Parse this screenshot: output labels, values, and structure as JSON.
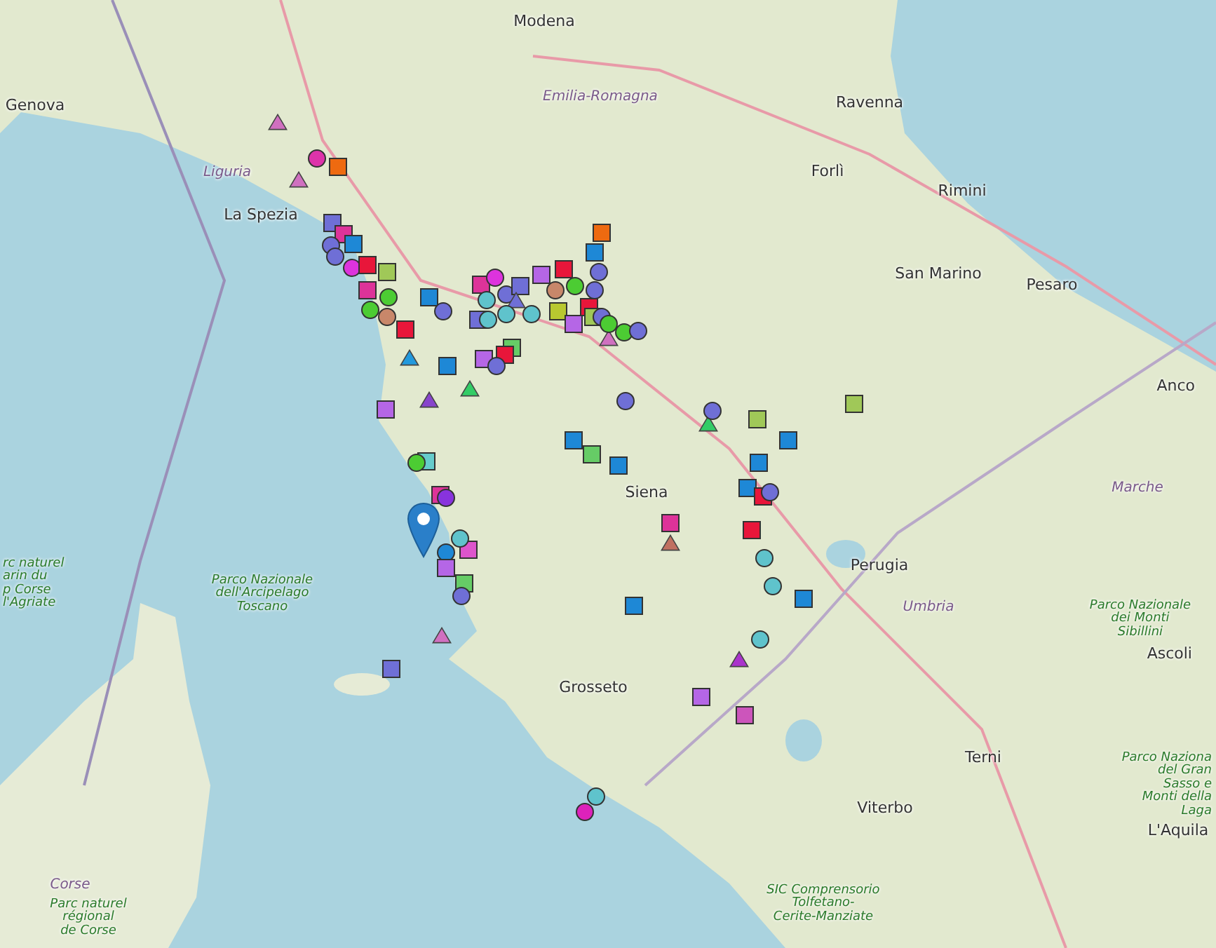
{
  "map": {
    "labels": [
      {
        "text": "Modena",
        "kind": "city"
      },
      {
        "text": "Genova",
        "kind": "city"
      },
      {
        "text": "Emilia-Romagna",
        "kind": "region"
      },
      {
        "text": "Ravenna",
        "kind": "city"
      },
      {
        "text": "Liguria",
        "kind": "region"
      },
      {
        "text": "Forlì",
        "kind": "city"
      },
      {
        "text": "Rimini",
        "kind": "city"
      },
      {
        "text": "La Spezia",
        "kind": "city"
      },
      {
        "text": "San Marino",
        "kind": "city"
      },
      {
        "text": "Pesaro",
        "kind": "city"
      },
      {
        "text": "Anco",
        "kind": "city"
      },
      {
        "text": "Siena",
        "kind": "city"
      },
      {
        "text": "Perugia",
        "kind": "city"
      },
      {
        "text": "Umbria",
        "kind": "region"
      },
      {
        "text": "Marche",
        "kind": "region"
      },
      {
        "text": "Grosseto",
        "kind": "city"
      },
      {
        "text": "Terni",
        "kind": "city"
      },
      {
        "text": "Viterbo",
        "kind": "city"
      },
      {
        "text": "Ascoli",
        "kind": "city"
      },
      {
        "text": "L'Aquila",
        "kind": "city"
      },
      {
        "text": "Parco Nazionale\ndell'Arcipelago\nToscano",
        "kind": "park"
      },
      {
        "text": "Parco Nazionale\ndei Monti\nSibillini",
        "kind": "park"
      },
      {
        "text": "rc naturel\narin du\np Corse\nl'Agriate",
        "kind": "park"
      },
      {
        "text": "Corse",
        "kind": "region"
      },
      {
        "text": "Parc naturel\nrégional\nde Corse",
        "kind": "park"
      },
      {
        "text": "Parco Naziona\ndel Gran\nSasso e\nMonti della\nLaga",
        "kind": "park"
      },
      {
        "text": "SIC Comprensorio\nTolfetano-\nCerite-Manziate",
        "kind": "park"
      }
    ],
    "markers": [
      {
        "kind": "triangle",
        "color": "#d070c0"
      },
      {
        "kind": "circle",
        "color": "#dd33aa"
      },
      {
        "kind": "square",
        "color": "#ee6a10"
      },
      {
        "kind": "triangle",
        "color": "#d070c0"
      },
      {
        "kind": "square",
        "color": "#6f6fd6"
      },
      {
        "kind": "square",
        "color": "#dd3399"
      },
      {
        "kind": "circle",
        "color": "#6f6fd6"
      },
      {
        "kind": "square",
        "color": "#1e88d6"
      },
      {
        "kind": "circle",
        "color": "#6f6fd6"
      },
      {
        "kind": "circle",
        "color": "#dd33dd"
      },
      {
        "kind": "square",
        "color": "#e8163a"
      },
      {
        "kind": "square",
        "color": "#a0c858"
      },
      {
        "kind": "square",
        "color": "#dd3399"
      },
      {
        "kind": "circle",
        "color": "#c8876a"
      },
      {
        "kind": "circle",
        "color": "#4ccc33"
      },
      {
        "kind": "circle",
        "color": "#4ccc33"
      },
      {
        "kind": "square",
        "color": "#e8163a"
      },
      {
        "kind": "square",
        "color": "#1e88d6"
      },
      {
        "kind": "circle",
        "color": "#6f6fd6"
      },
      {
        "kind": "triangle",
        "color": "#2299dd"
      },
      {
        "kind": "square",
        "color": "#1e88d6"
      },
      {
        "kind": "triangle",
        "color": "#8844cc"
      },
      {
        "kind": "triangle",
        "color": "#33cc66"
      },
      {
        "kind": "square",
        "color": "#b566e6"
      },
      {
        "kind": "square",
        "color": "#dd3399"
      },
      {
        "kind": "circle",
        "color": "#dd33dd"
      },
      {
        "kind": "circle",
        "color": "#5fc3cc"
      },
      {
        "kind": "circle",
        "color": "#6f6fd6"
      },
      {
        "kind": "square",
        "color": "#6f6fd6"
      },
      {
        "kind": "triangle",
        "color": "#6f6fd6"
      },
      {
        "kind": "square",
        "color": "#b566e6"
      },
      {
        "kind": "square",
        "color": "#e8163a"
      },
      {
        "kind": "circle",
        "color": "#c8876a"
      },
      {
        "kind": "circle",
        "color": "#4ccc33"
      },
      {
        "kind": "square",
        "color": "#e8163a"
      },
      {
        "kind": "square",
        "color": "#1e88d6"
      },
      {
        "kind": "circle",
        "color": "#6f6fd6"
      },
      {
        "kind": "circle",
        "color": "#6f6fd6"
      },
      {
        "kind": "square",
        "color": "#ee6a10"
      },
      {
        "kind": "square",
        "color": "#6f6fd6"
      },
      {
        "kind": "circle",
        "color": "#5fc3cc"
      },
      {
        "kind": "circle",
        "color": "#5fc3cc"
      },
      {
        "kind": "circle",
        "color": "#5fc3cc"
      },
      {
        "kind": "square",
        "color": "#b8c830"
      },
      {
        "kind": "square",
        "color": "#b566e6"
      },
      {
        "kind": "square",
        "color": "#a0c858"
      },
      {
        "kind": "circle",
        "color": "#6f6fd6"
      },
      {
        "kind": "triangle",
        "color": "#d070c0"
      },
      {
        "kind": "circle",
        "color": "#4ccc33"
      },
      {
        "kind": "circle",
        "color": "#4ccc33"
      },
      {
        "kind": "circle",
        "color": "#6f6fd6"
      },
      {
        "kind": "square",
        "color": "#b566e6"
      },
      {
        "kind": "square",
        "color": "#66cc66"
      },
      {
        "kind": "square",
        "color": "#e8163a"
      },
      {
        "kind": "circle",
        "color": "#6f6fd6"
      },
      {
        "kind": "circle",
        "color": "#6f6fd6"
      },
      {
        "kind": "triangle",
        "color": "#33cc66"
      },
      {
        "kind": "circle",
        "color": "#6f6fd6"
      },
      {
        "kind": "square",
        "color": "#a0c858"
      },
      {
        "kind": "square",
        "color": "#a0c858"
      },
      {
        "kind": "square",
        "color": "#1e88d6"
      },
      {
        "kind": "square",
        "color": "#66cc66"
      },
      {
        "kind": "square",
        "color": "#1e88d6"
      },
      {
        "kind": "square",
        "color": "#1e88d6"
      },
      {
        "kind": "square",
        "color": "#1e88d6"
      },
      {
        "kind": "square",
        "color": "#1e88d6"
      },
      {
        "kind": "square",
        "color": "#e8163a"
      },
      {
        "kind": "circle",
        "color": "#6f6fd6"
      },
      {
        "kind": "square",
        "color": "#e8163a"
      },
      {
        "kind": "square",
        "color": "#66cccc"
      },
      {
        "kind": "circle",
        "color": "#4ccc33"
      },
      {
        "kind": "square",
        "color": "#dd3399"
      },
      {
        "kind": "circle",
        "color": "#8833dd"
      },
      {
        "kind": "square",
        "color": "#dd3399"
      },
      {
        "kind": "triangle",
        "color": "#c07060"
      },
      {
        "kind": "circle",
        "color": "#1e88d6"
      },
      {
        "kind": "square",
        "color": "#dd55cc"
      },
      {
        "kind": "circle",
        "color": "#5fc3cc"
      },
      {
        "kind": "square",
        "color": "#b566e6"
      },
      {
        "kind": "square",
        "color": "#66cc66"
      },
      {
        "kind": "circle",
        "color": "#6f6fd6"
      },
      {
        "kind": "triangle",
        "color": "#d070c0"
      },
      {
        "kind": "circle",
        "color": "#5fc3cc"
      },
      {
        "kind": "circle",
        "color": "#5fc3cc"
      },
      {
        "kind": "square",
        "color": "#1e88d6"
      },
      {
        "kind": "square",
        "color": "#1e88d6"
      },
      {
        "kind": "circle",
        "color": "#5fc3cc"
      },
      {
        "kind": "triangle",
        "color": "#aa33cc"
      },
      {
        "kind": "square",
        "color": "#b566e6"
      },
      {
        "kind": "square",
        "color": "#cc55bb"
      },
      {
        "kind": "square",
        "color": "#6f6fd6"
      },
      {
        "kind": "circle",
        "color": "#5fc3cc"
      },
      {
        "kind": "circle",
        "color": "#dd22bb"
      }
    ]
  }
}
